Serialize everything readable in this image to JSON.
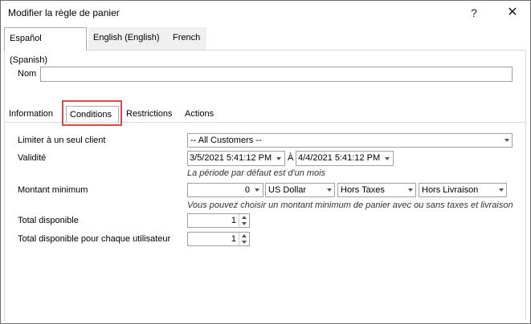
{
  "window": {
    "title": "Modifier la règle de panier",
    "help": "?",
    "close": "✕"
  },
  "lang_tabs": [
    "Español (Spanish)",
    "English (English)",
    "French"
  ],
  "name_field": {
    "label": "Nom",
    "value": ""
  },
  "sub_tabs": [
    "Information",
    "Conditions",
    "Restrictions",
    "Actions"
  ],
  "conditions": {
    "limit_label": "Limiter à un seul client",
    "limit_value": "-- All Customers --",
    "validity_label": "Validité",
    "validity_from": "3/5/2021 5:41:12 PM",
    "validity_to_label": "À",
    "validity_to": "4/4/2021 5:41:12 PM",
    "validity_hint": "La période par défaut est d'un mois",
    "min_amount_label": "Montant minimum",
    "min_amount_value": "0",
    "currency": "US Dollar",
    "tax": "Hors Taxes",
    "shipping": "Hors Livraison",
    "min_amount_hint": "Vous pouvez choisir un montant minimum de panier avec ou sans taxes et livraison",
    "total_label": "Total disponible",
    "total_value": "1",
    "per_user_label": "Total disponible pour chaque utilisateur",
    "per_user_value": "1"
  },
  "colors": {
    "highlight": "#e0464b"
  }
}
